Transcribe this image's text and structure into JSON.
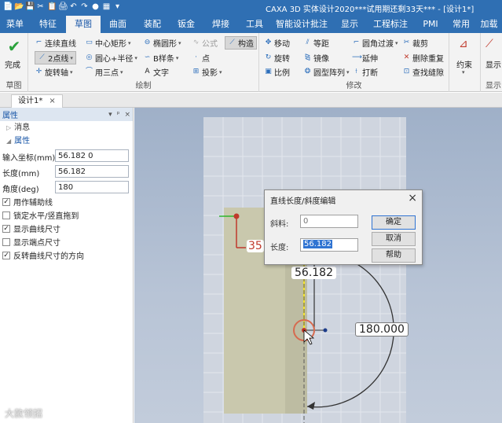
{
  "window": {
    "title": "CAXA 3D 实体设计2020***试用期还剩33天*** - [设计1*]"
  },
  "quick_access": [
    "📄",
    "📂",
    "💾",
    "✂",
    "📋",
    "🖨",
    "↶",
    "↷",
    "●",
    "▦",
    "▾"
  ],
  "menu_tabs": [
    {
      "label": "菜单",
      "active": false
    },
    {
      "label": "特征",
      "active": false
    },
    {
      "label": "草图",
      "active": true
    },
    {
      "label": "曲面",
      "active": false
    },
    {
      "label": "装配",
      "active": false
    },
    {
      "label": "钣金",
      "active": false
    },
    {
      "label": "焊接",
      "active": false
    },
    {
      "label": "工具",
      "active": false
    },
    {
      "label": "智能设计批注",
      "active": false
    },
    {
      "label": "显示",
      "active": false
    },
    {
      "label": "工程标注",
      "active": false
    },
    {
      "label": "PMI",
      "active": false
    },
    {
      "label": "常用",
      "active": false
    },
    {
      "label": "加载",
      "active": false
    }
  ],
  "ribbon": {
    "sketch_group": {
      "finish_label": "完成",
      "group_label": "草图"
    },
    "draw_group": {
      "group_label": "绘制",
      "row1": [
        "连续直线",
        "中心矩形",
        "椭圆形",
        "公式",
        "构造"
      ],
      "row2": [
        "2点线",
        "圆心+半径",
        "B样条",
        "点"
      ],
      "row3": [
        "旋转轴",
        "用三点",
        "文字",
        "投影"
      ]
    },
    "modify_group": {
      "group_label": "修改",
      "row1": [
        "移动",
        "等距",
        "圆角过渡",
        "裁剪"
      ],
      "row2": [
        "旋转",
        "镜像",
        "延伸",
        "删除重复"
      ],
      "row3": [
        "比例",
        "圆型阵列",
        "打断",
        "查找缝隙"
      ]
    },
    "constraint_group": {
      "label": "约束",
      "group_label": ""
    },
    "display_group": {
      "label": "显示",
      "group_label": "显示"
    }
  },
  "doc_tab": {
    "label": "设计1*",
    "close": "×"
  },
  "properties_panel": {
    "title": "属性",
    "header_icons": [
      "▾",
      "ᵖ",
      "×"
    ],
    "sections": {
      "message": "消息",
      "properties": "属性"
    },
    "fields": [
      {
        "label": "输入坐标(mm)",
        "value": "56.182 0"
      },
      {
        "label": "长度(mm)",
        "value": "56.182"
      },
      {
        "label": "角度(deg)",
        "value": "180"
      }
    ],
    "checkboxes": [
      {
        "label": "用作辅助线",
        "checked": true
      },
      {
        "label": "锁定水平/竖直拖到",
        "checked": false
      },
      {
        "label": "显示曲线尺寸",
        "checked": true
      },
      {
        "label": "显示端点尺寸",
        "checked": false
      },
      {
        "label": "反转曲线尺寸的方向",
        "checked": true
      }
    ]
  },
  "dialog": {
    "title": "直线长度/斜度编辑",
    "slope_label": "斜料:",
    "slope_value": "0",
    "length_label": "长度:",
    "length_value": "56.182",
    "ok_label": "确定",
    "cancel_label": "取消",
    "help_label": "帮助",
    "close": "×"
  },
  "canvas": {
    "length_dim": "56.182",
    "angle_dim": "180.000",
    "dim_35": "35"
  },
  "watermark": "大款领招"
}
